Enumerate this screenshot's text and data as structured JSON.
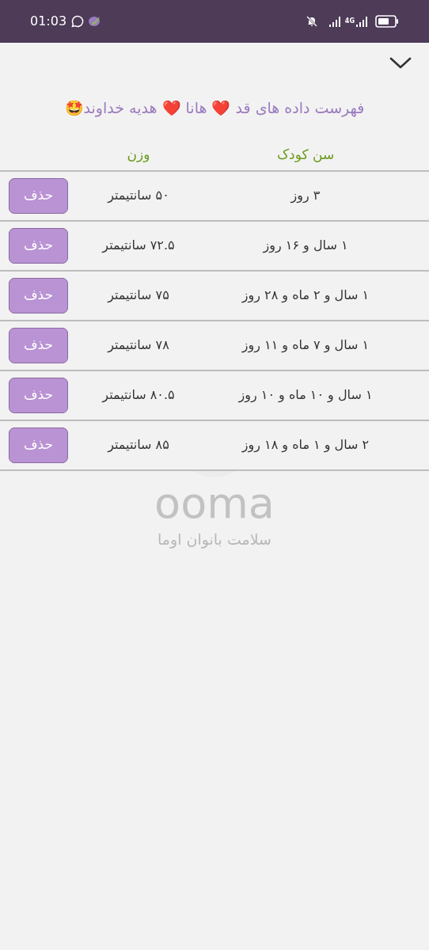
{
  "status_bar": {
    "time": "01:03",
    "network": "4G"
  },
  "title": "فهرست داده های قد ❤️ هانا ❤️ هدیه خداوند🤩",
  "table": {
    "columns": [
      "سن کودک",
      "وزن"
    ],
    "rows": [
      {
        "age": "۳ روز",
        "value": "۵۰ سانتیمتر",
        "action": "حذف"
      },
      {
        "age": "۱ سال و ۱۶ روز",
        "value": "۷۲.۵ سانتیمتر",
        "action": "حذف"
      },
      {
        "age": "۱ سال و ۲ ماه و ۲۸ روز",
        "value": "۷۵ سانتیمتر",
        "action": "حذف"
      },
      {
        "age": "۱ سال و ۷ ماه و ۱۱ روز",
        "value": "۷۸ سانتیمتر",
        "action": "حذف"
      },
      {
        "age": "۱ سال و ۱۰ ماه و ۱۰ روز",
        "value": "۸۰.۵ سانتیمتر",
        "action": "حذف"
      },
      {
        "age": "۲ سال و ۱ ماه و ۱۸ روز",
        "value": "۸۵ سانتیمتر",
        "action": "حذف"
      }
    ]
  },
  "background_logo": {
    "name": "ooma",
    "tagline": "سلامت بانوان اوما"
  }
}
